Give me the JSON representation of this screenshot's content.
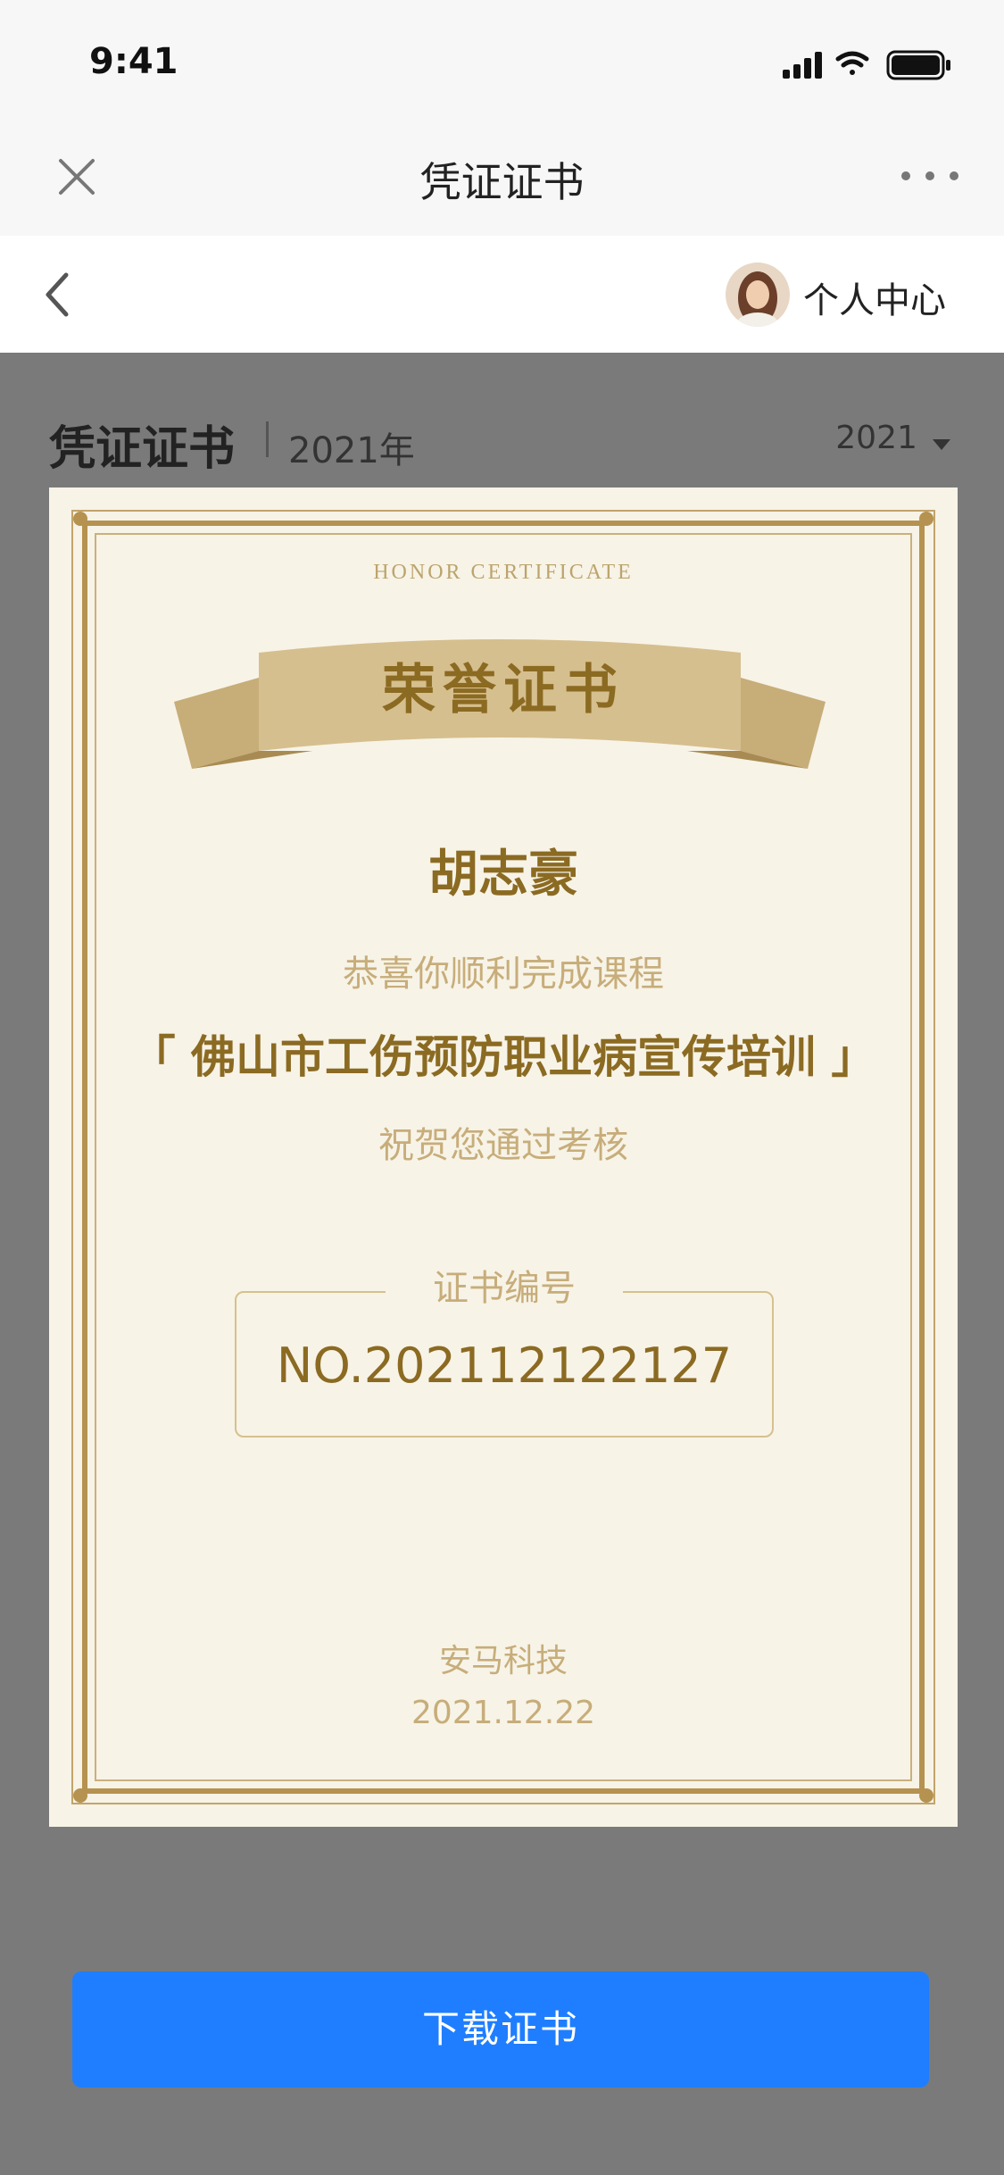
{
  "status_bar": {
    "time": "9:41"
  },
  "nav": {
    "title": "凭证证书"
  },
  "subbar": {
    "profile_label": "个人中心"
  },
  "section": {
    "title": "凭证证书",
    "year_text": "2021年",
    "year_select": "2021"
  },
  "certificate": {
    "honor_en": "HONOR CERTIFICATE",
    "title": "荣誉证书",
    "recipient": "胡志豪",
    "congrats": "恭喜你顺利完成课程",
    "course": "「 佛山市工伤预防职业病宣传培训 」",
    "pass_text": "祝贺您通过考核",
    "number_label": "证书编号",
    "number": "NO.202112122127",
    "issuer": "安马科技",
    "date": "2021.12.22"
  },
  "download_label": "下载证书",
  "colors": {
    "accent": "#1f7eff",
    "gold_dark": "#8b6a22",
    "gold_light": "#c7ad7a",
    "paper": "#f7f3e7",
    "overlay": "#7a7a7a"
  }
}
